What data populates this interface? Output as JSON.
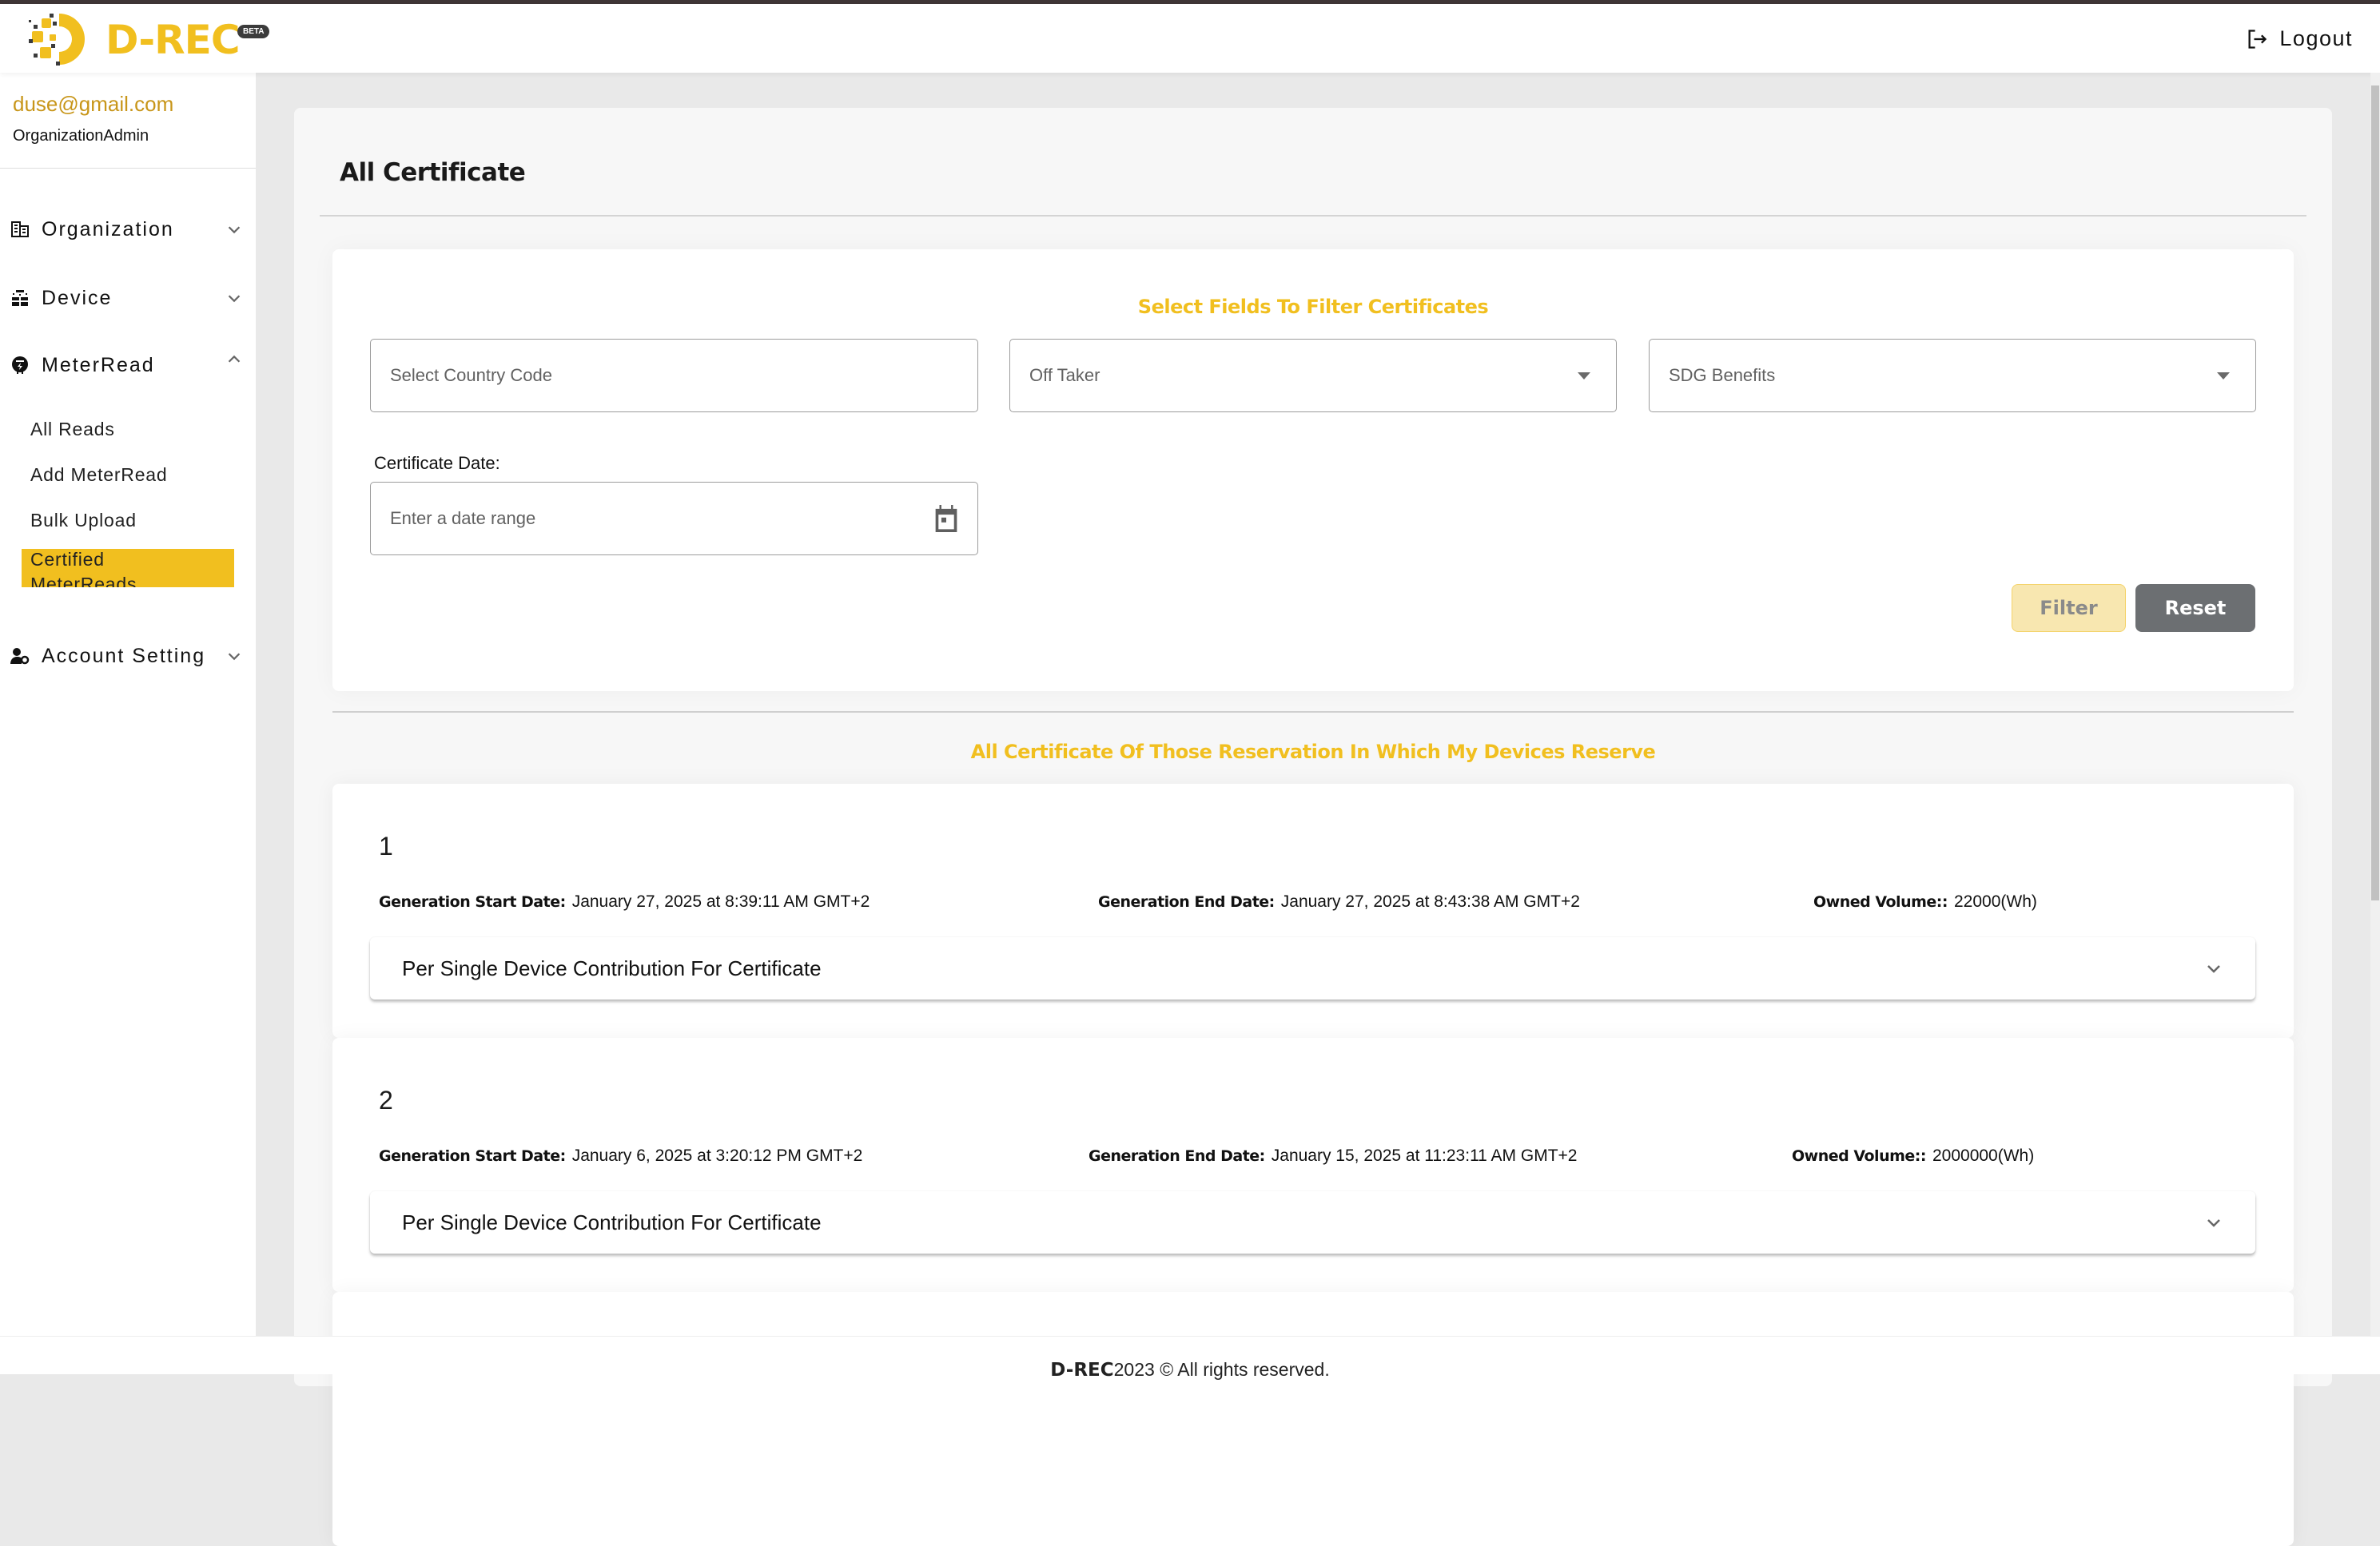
{
  "header": {
    "brand": "D-REC",
    "badge": "BETA",
    "logout_label": "Logout"
  },
  "user": {
    "email": "duse@gmail.com",
    "role": "OrganizationAdmin"
  },
  "sidebar": {
    "items": [
      {
        "label": "Organization",
        "icon": "building-icon",
        "expanded": false
      },
      {
        "label": "Device",
        "icon": "solar-panel-icon",
        "expanded": false
      },
      {
        "label": "MeterRead",
        "icon": "meter-icon",
        "expanded": true
      },
      {
        "label": "Account Setting",
        "icon": "user-gear-icon",
        "expanded": false
      }
    ],
    "meterread_sub": [
      {
        "label": "All Reads"
      },
      {
        "label": "Add MeterRead"
      },
      {
        "label": "Bulk Upload"
      },
      {
        "label": "Certified MeterReads",
        "active": true
      }
    ]
  },
  "page": {
    "title": "All Certificate"
  },
  "filters": {
    "heading": "Select Fields To Filter Certificates",
    "country_placeholder": "Select Country Code",
    "offtaker_placeholder": "Off Taker",
    "sdg_placeholder": "SDG Benefits",
    "cert_date_label": "Certificate Date:",
    "date_placeholder": "Enter a date range",
    "filter_label": "Filter",
    "reset_label": "Reset"
  },
  "certificates_section": {
    "heading": "All Certificate Of Those Reservation In Which My Devices Reserve",
    "start_label": "Generation Start Date:",
    "end_label": "Generation End Date:",
    "volume_label": "Owned Volume::",
    "accordion_label": "Per Single Device Contribution For Certificate",
    "items": [
      {
        "number": "1",
        "start": "January 27, 2025 at 8:39:11 AM GMT+2",
        "end": "January 27, 2025 at 8:43:38 AM GMT+2",
        "volume": "22000(Wh)"
      },
      {
        "number": "2",
        "start": "January 6, 2025 at 3:20:12 PM GMT+2",
        "end": "January 15, 2025 at 11:23:11 AM GMT+2",
        "volume": "2000000(Wh)"
      }
    ]
  },
  "footer": {
    "brand": "D-REC",
    "text": " 2023 © All rights reserved."
  },
  "colors": {
    "accent": "#f1bf1f",
    "email": "#c8961a",
    "reset_button": "#6c6f72",
    "filter_button_disabled": "#f8e7b0"
  }
}
